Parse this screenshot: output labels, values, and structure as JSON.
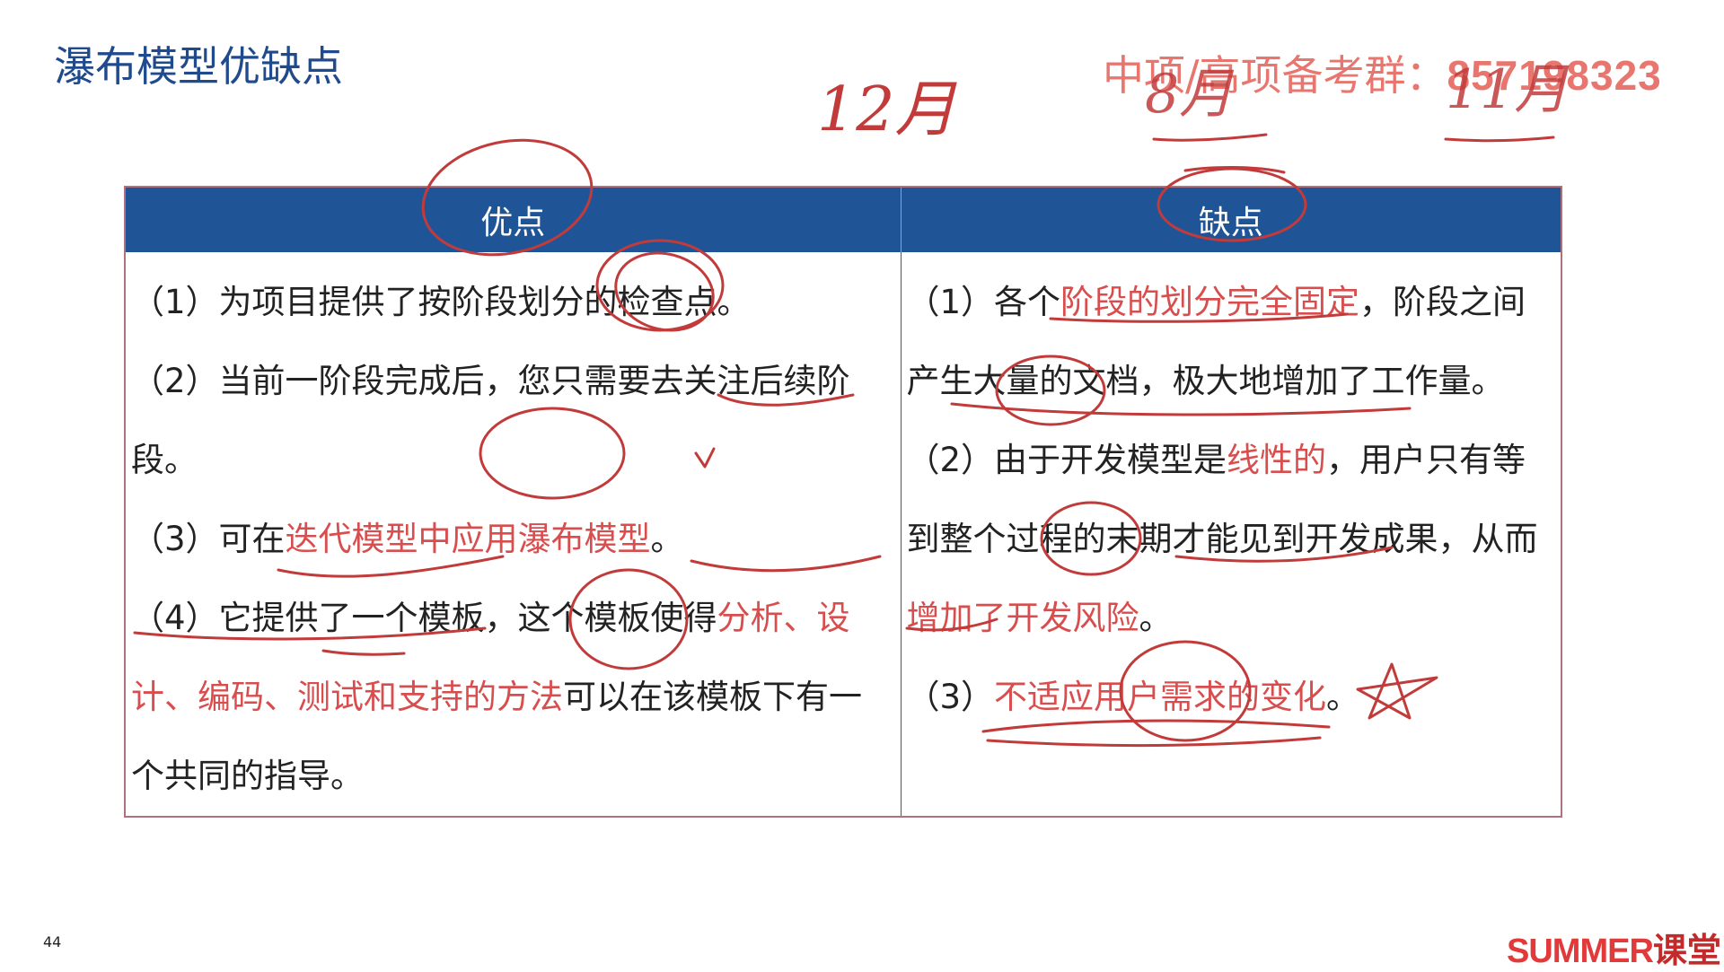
{
  "slide": {
    "title": "瀑布模型优缺点",
    "group_text": "中项/高项备考群：",
    "group_number": "857198323",
    "page_number": "44",
    "logo_en": "SUMMER",
    "logo_cn": "课堂"
  },
  "handwriting": {
    "date_1": "12月",
    "date_2": "8月",
    "date_3": "11月"
  },
  "table": {
    "headers": [
      "优点",
      "缺点"
    ],
    "pros": [
      {
        "text": "（1）为项目提供了按阶段划分的检查点。"
      },
      {
        "text": "（2）当前一阶段完成后，您只需要去关注后续阶段。"
      },
      {
        "pre": "（3）可在",
        "hl": "迭代模型中应用瀑布模型",
        "post": "。"
      },
      {
        "pre": "（4）它提供了一个模板，这个模板使得",
        "hl1": "分析、设计、",
        "hl2": "编码、测试和支持的方法",
        "post": "可以在该模板下有一个共同的指导。"
      }
    ],
    "cons": [
      {
        "pre": "（1）各个",
        "hl": "阶段的划分完全固定",
        "post": "，阶段之间产生大量的文档，极大地增加了工作量。"
      },
      {
        "pre": "（2）由于开发模型是",
        "hl": "线性的",
        "mid": "，用户只有等到整个过程的末期才能见到开发成果，从而",
        "hl2": "增加了开发风险",
        "post": "。"
      },
      {
        "pre": "（3）",
        "hl": "不适应用户需求的变化",
        "post": "。"
      }
    ]
  },
  "colors": {
    "title": "#1f4a8c",
    "header_bg": "#1f5597",
    "highlight": "#d84d4d",
    "ink": "#c23b3b"
  }
}
